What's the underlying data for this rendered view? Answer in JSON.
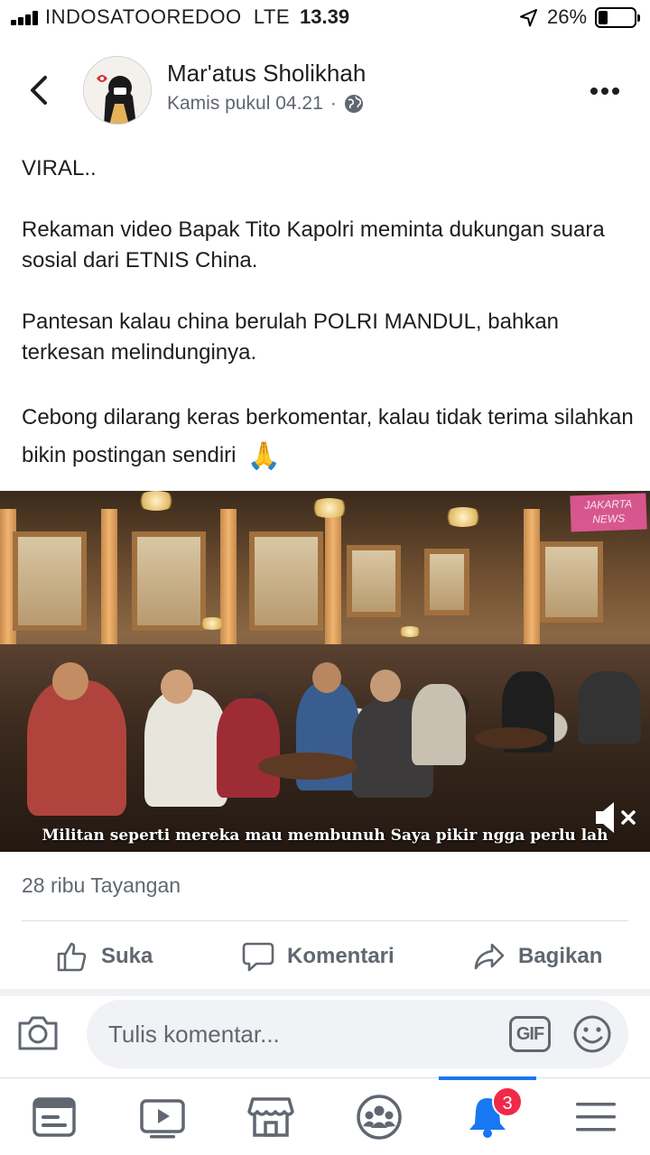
{
  "status_bar": {
    "carrier": "INDOSATOOREDOO",
    "network": "LTE",
    "time": "13.39",
    "battery_percent": "26%",
    "battery_level": 0.26
  },
  "post": {
    "author": "Mar'atus Sholikhah",
    "timestamp": "Kamis pukul 04.21",
    "separator": "·",
    "paragraphs": [
      "VIRAL..",
      "Rekaman video Bapak Tito Kapolri meminta dukungan suara sosial dari ETNIS China.",
      "Pantesan kalau china berulah POLRI MANDUL, bahkan terkesan melindunginya.",
      "Cebong dilarang keras berkomentar, kalau tidak terima silahkan bikin postingan sendiri"
    ],
    "emoji": "🙏",
    "video": {
      "caption": "Militan seperti mereka mau membunuh Saya pikir ngga perlu lah",
      "watermark_line1": "JAKARTA",
      "watermark_line2": "NEWS"
    },
    "views": "28 ribu Tayangan"
  },
  "actions": {
    "like": "Suka",
    "comment": "Komentari",
    "share": "Bagikan"
  },
  "comment_bar": {
    "placeholder": "Tulis komentar...",
    "gif_label": "GIF"
  },
  "bottom_nav": {
    "notifications_badge": "3"
  },
  "colors": {
    "accent": "#1877f2",
    "text": "#1c1e21",
    "secondary": "#606770",
    "badge": "#f02849"
  }
}
